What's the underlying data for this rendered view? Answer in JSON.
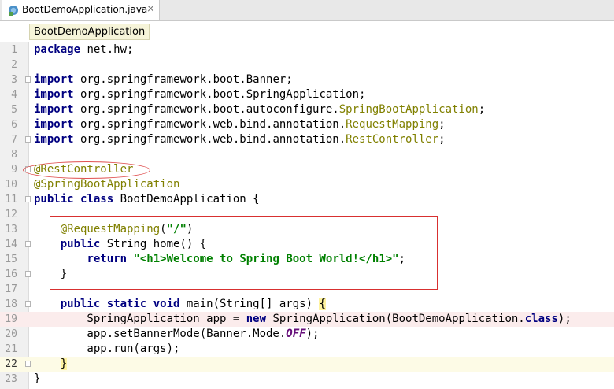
{
  "tab": {
    "label": "BootDemoApplication.java",
    "close": "×"
  },
  "breadcrumb": {
    "label": "BootDemoApplication"
  },
  "lines": [
    {
      "n": "1",
      "tokens": [
        [
          "kw",
          "package"
        ],
        [
          "p",
          " net.hw;"
        ]
      ]
    },
    {
      "n": "2",
      "tokens": []
    },
    {
      "n": "3",
      "tokens": [
        [
          "kw",
          "import"
        ],
        [
          "p",
          " org.springframework.boot.Banner;"
        ]
      ]
    },
    {
      "n": "4",
      "tokens": [
        [
          "kw",
          "import"
        ],
        [
          "p",
          " org.springframework.boot.SpringApplication;"
        ]
      ]
    },
    {
      "n": "5",
      "tokens": [
        [
          "kw",
          "import"
        ],
        [
          "p",
          " org.springframework.boot.autoconfigure."
        ],
        [
          "ann",
          "SpringBootApplication"
        ],
        [
          "p",
          ";"
        ]
      ]
    },
    {
      "n": "6",
      "tokens": [
        [
          "kw",
          "import"
        ],
        [
          "p",
          " org.springframework.web.bind.annotation."
        ],
        [
          "ann",
          "RequestMapping"
        ],
        [
          "p",
          ";"
        ]
      ]
    },
    {
      "n": "7",
      "tokens": [
        [
          "kw",
          "import"
        ],
        [
          "p",
          " org.springframework.web.bind.annotation."
        ],
        [
          "ann",
          "RestController"
        ],
        [
          "p",
          ";"
        ]
      ]
    },
    {
      "n": "8",
      "tokens": []
    },
    {
      "n": "9",
      "tokens": [
        [
          "ann",
          "@RestController"
        ]
      ]
    },
    {
      "n": "10",
      "tokens": [
        [
          "ann",
          "@SpringBootApplication"
        ]
      ]
    },
    {
      "n": "11",
      "tokens": [
        [
          "kw",
          "public class"
        ],
        [
          "p",
          " BootDemoApplication {"
        ]
      ]
    },
    {
      "n": "12",
      "tokens": []
    },
    {
      "n": "13",
      "tokens": [
        [
          "p",
          "    "
        ],
        [
          "ann",
          "@RequestMapping"
        ],
        [
          "p",
          "("
        ],
        [
          "str",
          "\"/\""
        ],
        [
          "p",
          ")"
        ]
      ]
    },
    {
      "n": "14",
      "tokens": [
        [
          "p",
          "    "
        ],
        [
          "kw",
          "public"
        ],
        [
          "p",
          " String home() {"
        ]
      ]
    },
    {
      "n": "15",
      "tokens": [
        [
          "p",
          "        "
        ],
        [
          "kw",
          "return"
        ],
        [
          "p",
          " "
        ],
        [
          "str",
          "\"<h1>Welcome to Spring Boot World!</h1>\""
        ],
        [
          "p",
          ";"
        ]
      ]
    },
    {
      "n": "16",
      "tokens": [
        [
          "p",
          "    }"
        ]
      ]
    },
    {
      "n": "17",
      "tokens": []
    },
    {
      "n": "18",
      "tokens": [
        [
          "p",
          "    "
        ],
        [
          "kw",
          "public static void"
        ],
        [
          "p",
          " main(String[] args) "
        ],
        [
          "bm",
          "{"
        ]
      ]
    },
    {
      "n": "19",
      "tokens": [
        [
          "p",
          "        SpringApplication app = "
        ],
        [
          "kw",
          "new"
        ],
        [
          "p",
          " SpringApplication(BootDemoApplication."
        ],
        [
          "kw",
          "class"
        ],
        [
          "p",
          ");"
        ]
      ]
    },
    {
      "n": "20",
      "tokens": [
        [
          "p",
          "        app.setBannerMode(Banner.Mode."
        ],
        [
          "const",
          "OFF"
        ],
        [
          "p",
          ");"
        ]
      ]
    },
    {
      "n": "21",
      "tokens": [
        [
          "p",
          "        app.run(args);"
        ]
      ]
    },
    {
      "n": "22",
      "tokens": [
        [
          "p",
          "    "
        ],
        [
          "bm",
          "}"
        ]
      ]
    },
    {
      "n": "23",
      "tokens": [
        [
          "p",
          "}"
        ]
      ]
    }
  ]
}
